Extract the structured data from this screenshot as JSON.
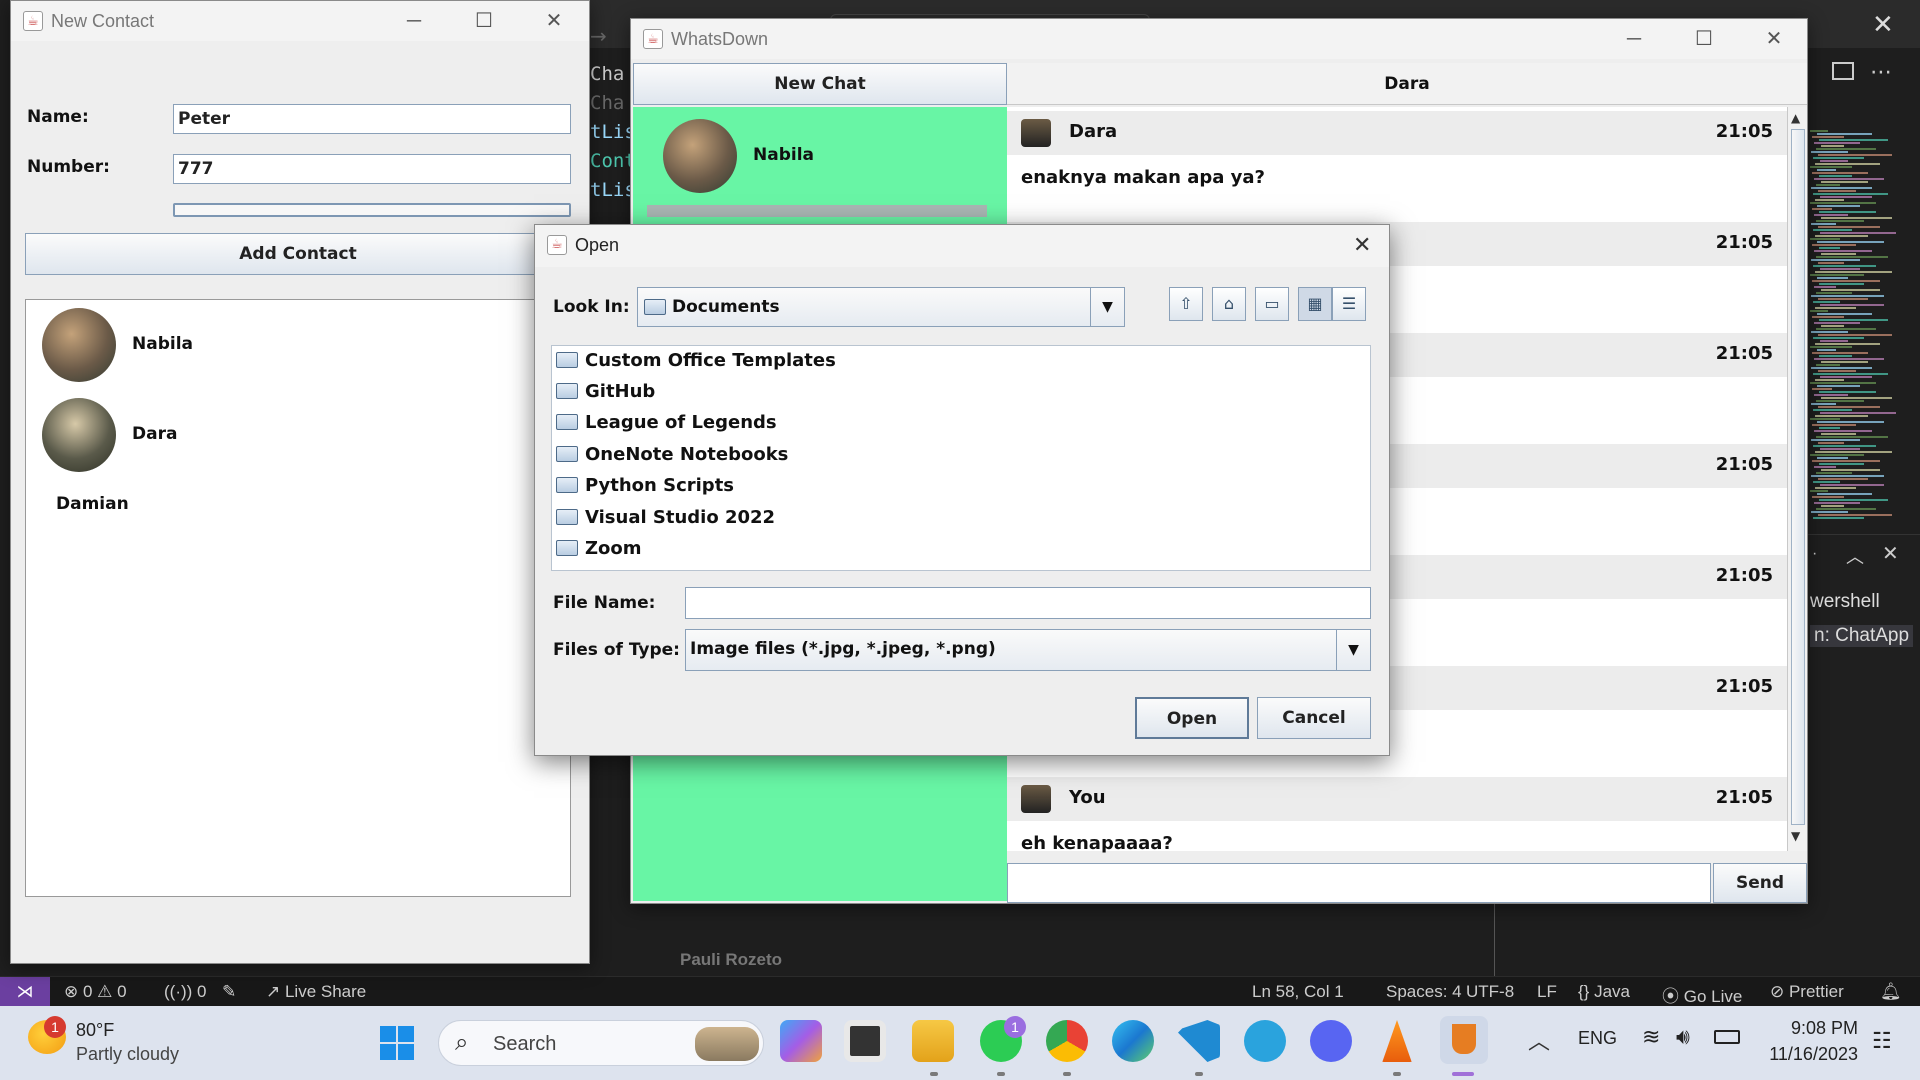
{
  "editor": {
    "code_fragments": [
      "Cha",
      "Cha",
      "tLis",
      "Cont",
      "tLis"
    ],
    "terminal_lines": [
      "wershell",
      "n: ChatApp"
    ],
    "terminal_partial_text": "Pauli Rozeto"
  },
  "status_bar": {
    "errors": "0",
    "warnings": "0",
    "ports": "0",
    "live_share": "Live Share",
    "position": "Ln 58, Col 1",
    "spaces": "Spaces: 4",
    "encoding": "UTF-8",
    "eol": "LF",
    "language": "Java",
    "go_live": "Go Live",
    "prettier": "Prettier"
  },
  "taskbar": {
    "weather_temp": "80°F",
    "weather_desc": "Partly cloudy",
    "weather_badge": "1",
    "search_placeholder": "Search",
    "whatsapp_badge": "1",
    "language": "ENG",
    "time": "9:08 PM",
    "date": "11/16/2023",
    "apps": [
      "copilot-pre",
      "notepad",
      "file-explorer",
      "whatsapp",
      "chrome",
      "edge",
      "vscode",
      "telegram",
      "discord",
      "vlc",
      "java"
    ]
  },
  "new_contact": {
    "title": "New Contact",
    "name_label": "Name:",
    "name_value": "Peter",
    "number_label": "Number:",
    "number_value": "777",
    "add_button": "Add Contact",
    "contacts": [
      "Nabila",
      "Dara",
      "Damian"
    ]
  },
  "whatsdown": {
    "title": "WhatsDown",
    "new_chat": "New Chat",
    "chat_header": "Dara",
    "chat_list": [
      "Nabila"
    ],
    "messages": [
      {
        "sender": "Dara",
        "time": "21:05",
        "text": "enaknya makan apa ya?"
      },
      {
        "sender": "",
        "time": "21:05",
        "text": ""
      },
      {
        "sender": "",
        "time": "21:05",
        "text": ""
      },
      {
        "sender": "",
        "time": "21:05",
        "text": ""
      },
      {
        "sender": "",
        "time": "21:05",
        "text": ""
      },
      {
        "sender": "",
        "time": "21:05",
        "text": ""
      },
      {
        "sender": "You",
        "time": "21:05",
        "text": "eh kenapaaaa?"
      }
    ],
    "send": "Send"
  },
  "open_dialog": {
    "title": "Open",
    "look_in_label": "Look In:",
    "look_in_value": "Documents",
    "folders": [
      "Custom Office Templates",
      "GitHub",
      "League of Legends",
      "OneNote Notebooks",
      "Python Scripts",
      "Visual Studio 2022",
      "Zoom"
    ],
    "file_name_label": "File Name:",
    "file_name_value": "",
    "file_type_label": "Files of Type:",
    "file_type_value": "Image files (*.jpg, *.jpeg, *.png)",
    "open_button": "Open",
    "cancel_button": "Cancel"
  },
  "colors": {
    "chat_list_bg": "#68f5a5",
    "vscode_bg": "#1e1e1e",
    "taskbar_bg": "#dde3ee",
    "remote_btn": "#6b3fa0"
  }
}
